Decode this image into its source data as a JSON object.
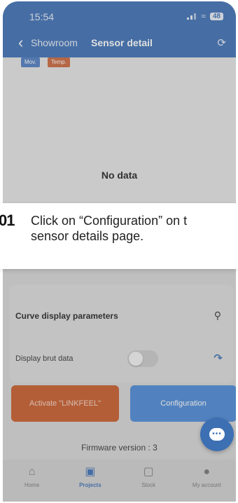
{
  "status_bar": {
    "time": "15:54",
    "battery": "48"
  },
  "header": {
    "back_label": "Showroom",
    "title": "Sensor detail"
  },
  "chart": {
    "tags": [
      "Mov.",
      "Temp."
    ],
    "empty_message": "No data"
  },
  "tooltip": {
    "step": "01",
    "text_line1": "Click on “Configuration” on t",
    "text_line2": "sensor details page."
  },
  "params": {
    "title": "Curve display parameters",
    "brut_label": "Display brut data",
    "brut_enabled": false
  },
  "buttons": {
    "activate": "Activate \"LINKFEEL\"",
    "configuration": "Configuration"
  },
  "firmware": "Firmware version : 3",
  "tabbar": {
    "items": [
      {
        "label": "Home",
        "icon": "home-icon",
        "active": false
      },
      {
        "label": "Projects",
        "icon": "briefcase-icon",
        "active": true
      },
      {
        "label": "Stock",
        "icon": "box-icon",
        "active": false
      },
      {
        "label": "My account",
        "icon": "user-icon",
        "active": false
      }
    ]
  },
  "colors": {
    "header": "#3c6fb5",
    "activate": "#c85a2a",
    "configuration": "#4a88d6"
  }
}
